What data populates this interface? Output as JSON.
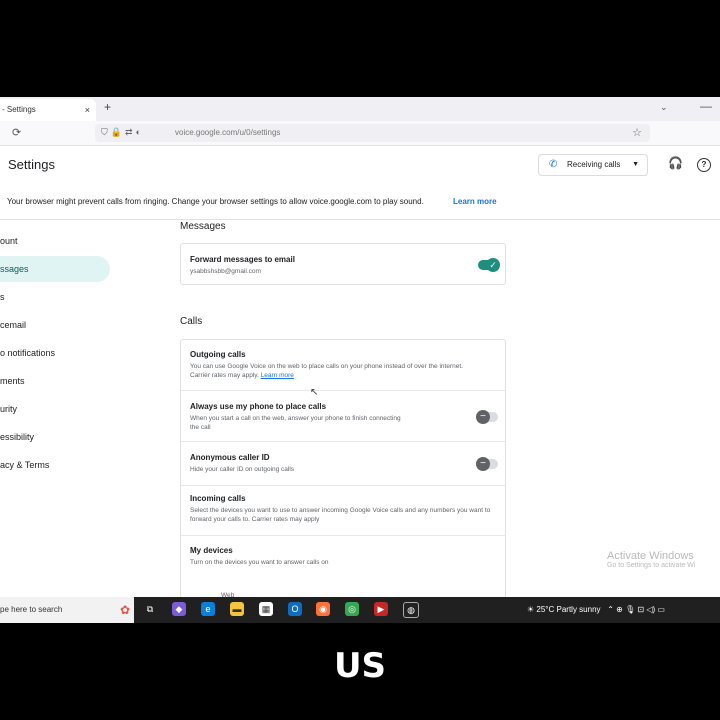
{
  "browser": {
    "tab_title": "- Settings",
    "tab_close": "×",
    "new_tab": "+",
    "tab_menu": "⌄",
    "url": "voice.google.com/u/0/settings"
  },
  "header": {
    "title": "Settings",
    "status_button": "Receiving calls"
  },
  "banner": {
    "message": "Your browser might prevent calls from ringing. Change your browser settings to allow voice.google.com to play sound.",
    "link": "Learn more"
  },
  "sidebar": {
    "items": [
      {
        "label": "ount"
      },
      {
        "label": "ssages"
      },
      {
        "label": "s"
      },
      {
        "label": "cemail"
      },
      {
        "label": "o notifications"
      },
      {
        "label": "ments"
      },
      {
        "label": "urity"
      },
      {
        "label": "essibility"
      },
      {
        "label": "acy & Terms"
      }
    ]
  },
  "messages": {
    "section_title": "Messages",
    "forward_title": "Forward messages to email",
    "forward_email": "ysabbshsbb@gmail.com",
    "forward_enabled": true
  },
  "calls": {
    "section_title": "Calls",
    "outgoing_title": "Outgoing calls",
    "outgoing_desc": "You can use Google Voice on the web to place calls on your phone instead of over the internet. Carrier rates may apply.",
    "outgoing_link": "Learn more",
    "always_phone_title": "Always use my phone to place calls",
    "always_phone_desc": "When you start a call on the web, answer your phone to finish connecting the call",
    "always_phone_enabled": false,
    "anon_title": "Anonymous caller ID",
    "anon_desc": "Hide your caller ID on outgoing calls",
    "anon_enabled": false,
    "incoming_title": "Incoming calls",
    "incoming_desc": "Select the devices you want to use to answer incoming Google Voice calls and any numbers you want to forward your calls to. Carrier rates may apply",
    "devices_title": "My devices",
    "devices_desc": "Turn on the devices you want to answer calls on",
    "web_label": "Web"
  },
  "watermark": {
    "line1": "Activate Windows",
    "line2": "Go to Settings to activate Wi"
  },
  "taskbar": {
    "search_placeholder": "pe here to search",
    "weather": "25°C  Partly sunny"
  },
  "caption": "US",
  "colors": {
    "accent_teal": "#1e8e7e",
    "link_blue": "#1a73e8",
    "active_nav_bg": "#e0f4f3"
  }
}
